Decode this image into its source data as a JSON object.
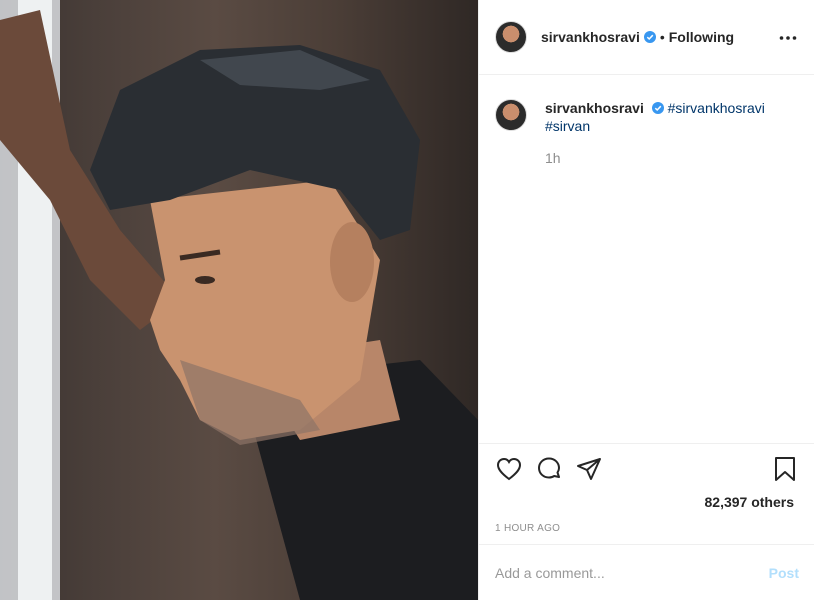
{
  "post": {
    "username": "sirvankhosravi",
    "follow_status": "Following",
    "separator": "•",
    "verified_icon": "verified-badge-icon",
    "caption": {
      "username": "sirvankhosravi",
      "hashtags": [
        "#sirvankhosravi",
        "#sirvan"
      ],
      "time": "1h"
    },
    "likes_text": "82,397 others",
    "time_ago": "1 HOUR AGO"
  },
  "comment": {
    "placeholder": "Add a comment...",
    "post_label": "Post"
  },
  "colors": {
    "verified": "#3897f0",
    "hashtag": "#003569",
    "post_button": "#b2dffc"
  },
  "icons": [
    "more-options-icon",
    "heart-icon",
    "comment-icon",
    "share-icon",
    "bookmark-icon"
  ]
}
